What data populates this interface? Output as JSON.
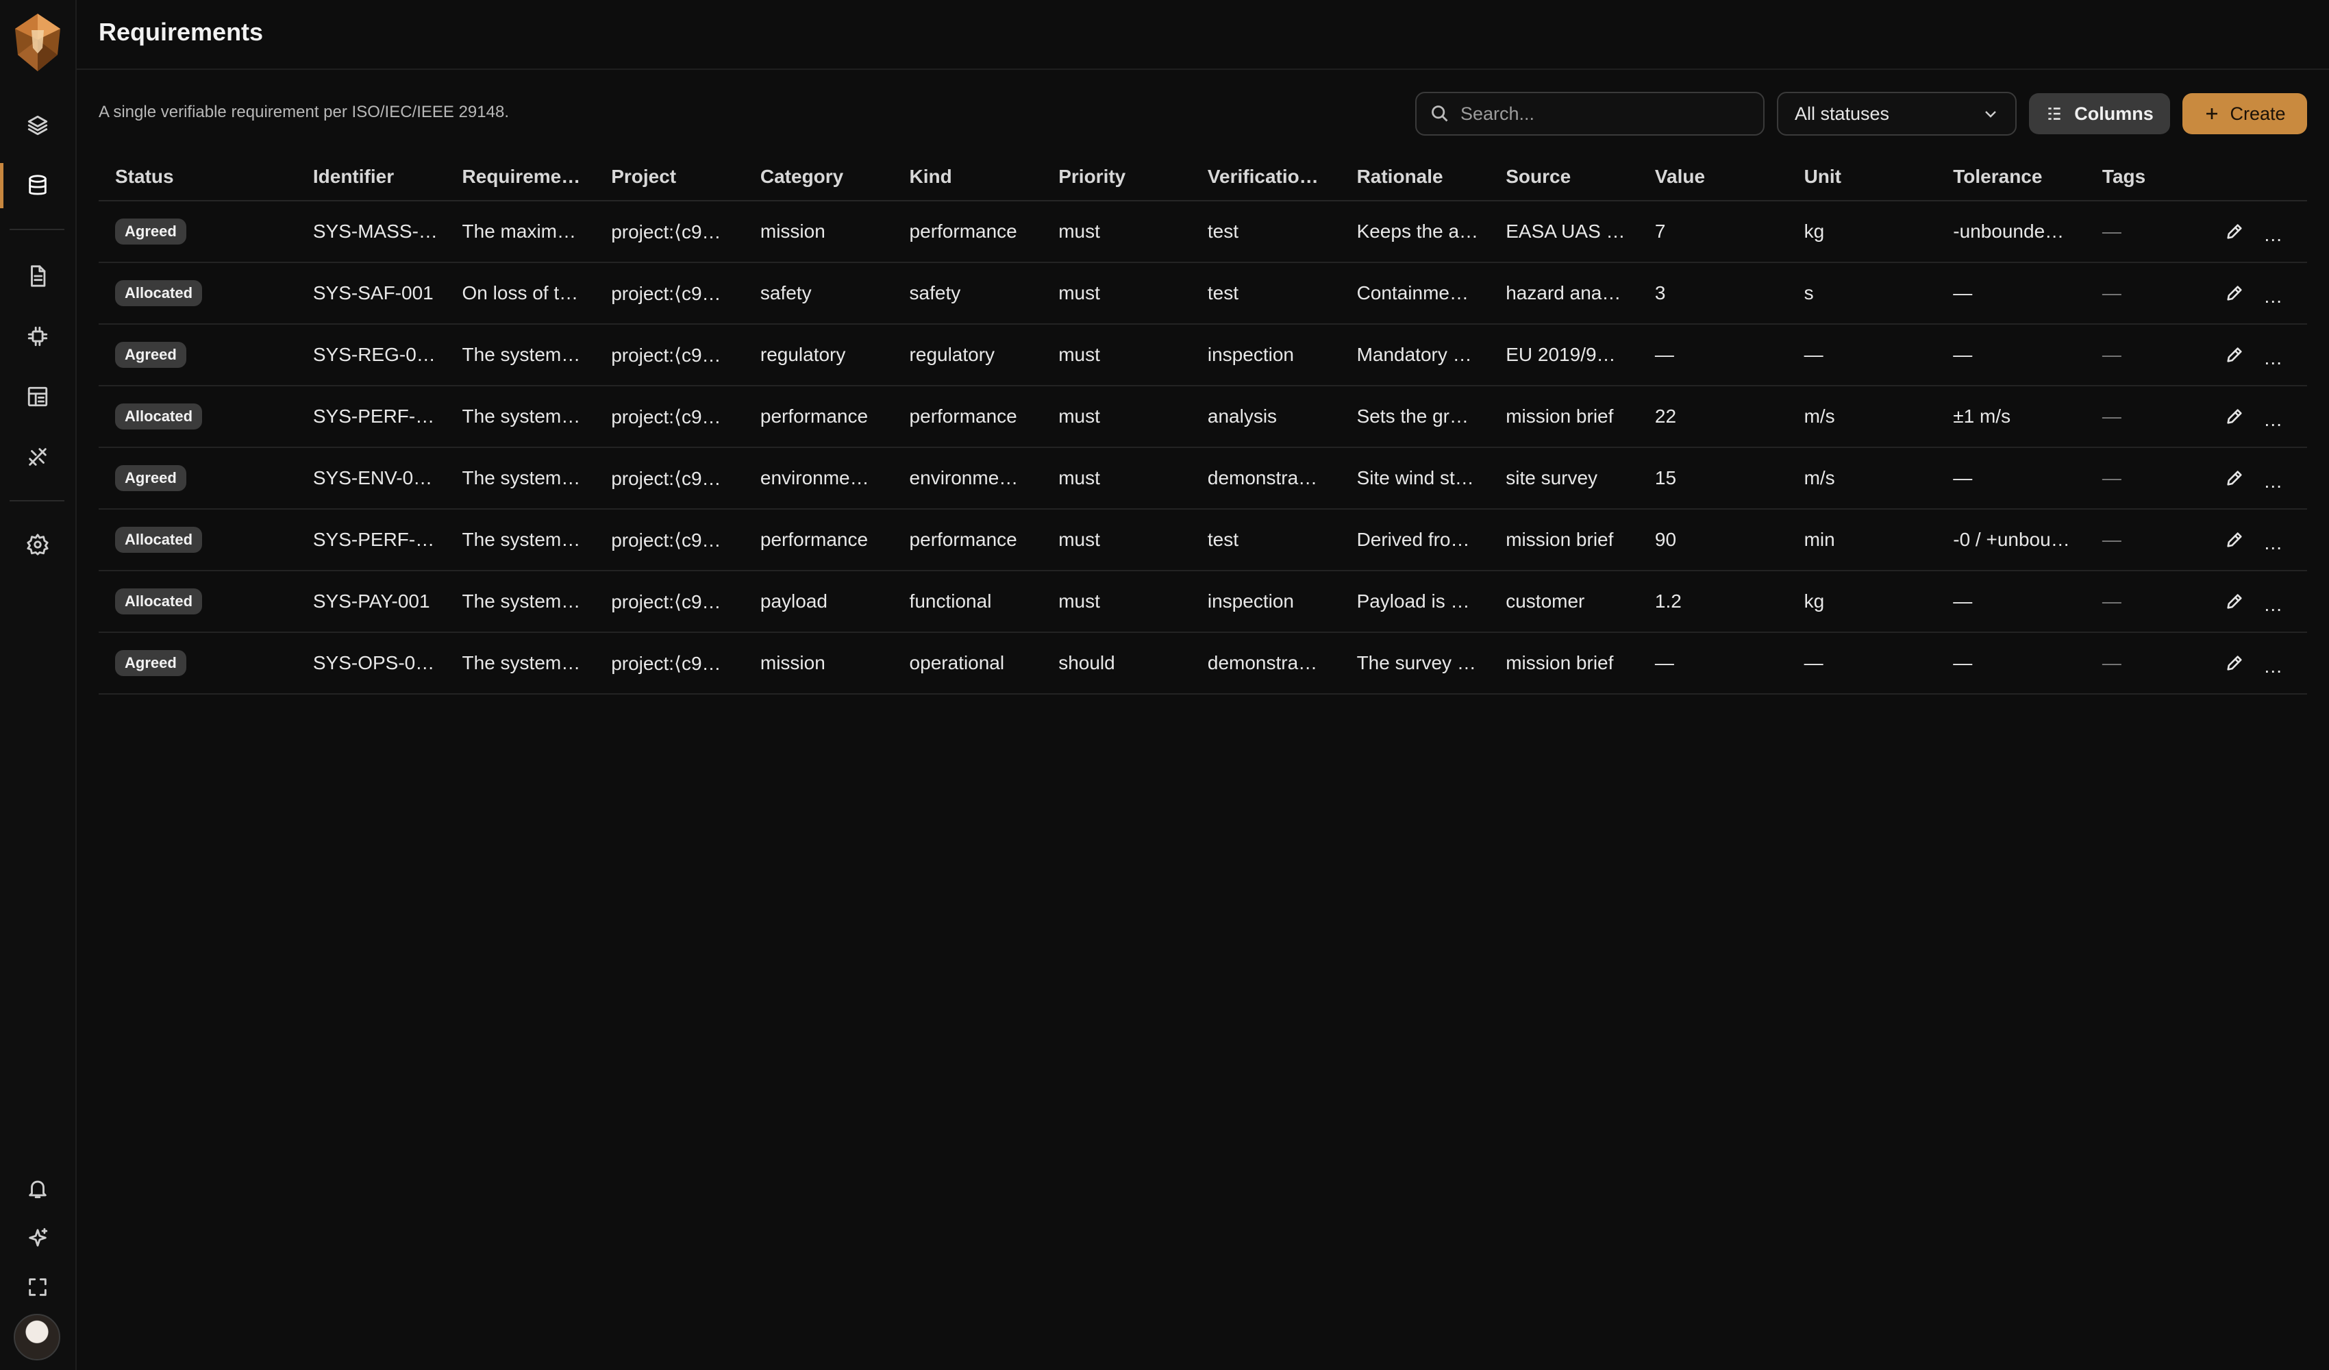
{
  "page": {
    "title": "Requirements",
    "description": "A single verifiable requirement per ISO/IEC/IEEE 29148."
  },
  "sidebar": {
    "top_items": [
      {
        "name": "layers-icon",
        "active": false
      },
      {
        "name": "database-icon",
        "active": true
      }
    ],
    "mid_items": [
      {
        "name": "document-icon"
      },
      {
        "name": "chip-icon"
      },
      {
        "name": "list-layout-icon"
      },
      {
        "name": "tools-icon"
      }
    ],
    "settings_icon": "gear-icon",
    "bottom_items": [
      {
        "name": "bell-icon"
      },
      {
        "name": "sparkle-icon"
      },
      {
        "name": "fullscreen-icon"
      }
    ]
  },
  "toolbar": {
    "search_placeholder": "Search...",
    "status_filter": "All statuses",
    "columns_label": "Columns",
    "create_label": "Create"
  },
  "table": {
    "columns": [
      "Status",
      "Identifier",
      "Requireme…",
      "Project",
      "Category",
      "Kind",
      "Priority",
      "Verificatio…",
      "Rationale",
      "Source",
      "Value",
      "Unit",
      "Tolerance",
      "Tags"
    ],
    "rows": [
      {
        "status": "Agreed",
        "identifier": "SYS-MASS-…",
        "requirement": "The maxim…",
        "project": "project:⟨c9…",
        "category": "mission",
        "kind": "performance",
        "priority": "must",
        "verification": "test",
        "rationale": "Keeps the a…",
        "source": "EASA UAS …",
        "value": "7",
        "unit": "kg",
        "tolerance": "-unbounde…",
        "tags": "—"
      },
      {
        "status": "Allocated",
        "identifier": "SYS-SAF-001",
        "requirement": "On loss of t…",
        "project": "project:⟨c9…",
        "category": "safety",
        "kind": "safety",
        "priority": "must",
        "verification": "test",
        "rationale": "Containme…",
        "source": "hazard ana…",
        "value": "3",
        "unit": "s",
        "tolerance": "—",
        "tags": "—"
      },
      {
        "status": "Agreed",
        "identifier": "SYS-REG-0…",
        "requirement": "The system…",
        "project": "project:⟨c9…",
        "category": "regulatory",
        "kind": "regulatory",
        "priority": "must",
        "verification": "inspection",
        "rationale": "Mandatory …",
        "source": "EU 2019/9…",
        "value": "—",
        "unit": "—",
        "tolerance": "—",
        "tags": "—"
      },
      {
        "status": "Allocated",
        "identifier": "SYS-PERF-…",
        "requirement": "The system…",
        "project": "project:⟨c9…",
        "category": "performance",
        "kind": "performance",
        "priority": "must",
        "verification": "analysis",
        "rationale": "Sets the gr…",
        "source": "mission brief",
        "value": "22",
        "unit": "m/s",
        "tolerance": "±1 m/s",
        "tags": "—"
      },
      {
        "status": "Agreed",
        "identifier": "SYS-ENV-0…",
        "requirement": "The system…",
        "project": "project:⟨c9…",
        "category": "environme…",
        "kind": "environme…",
        "priority": "must",
        "verification": "demonstra…",
        "rationale": "Site wind st…",
        "source": "site survey",
        "value": "15",
        "unit": "m/s",
        "tolerance": "—",
        "tags": "—"
      },
      {
        "status": "Allocated",
        "identifier": "SYS-PERF-…",
        "requirement": "The system…",
        "project": "project:⟨c9…",
        "category": "performance",
        "kind": "performance",
        "priority": "must",
        "verification": "test",
        "rationale": "Derived fro…",
        "source": "mission brief",
        "value": "90",
        "unit": "min",
        "tolerance": "-0 / +unbou…",
        "tags": "—"
      },
      {
        "status": "Allocated",
        "identifier": "SYS-PAY-001",
        "requirement": "The system…",
        "project": "project:⟨c9…",
        "category": "payload",
        "kind": "functional",
        "priority": "must",
        "verification": "inspection",
        "rationale": "Payload is …",
        "source": "customer",
        "value": "1.2",
        "unit": "kg",
        "tolerance": "—",
        "tags": "—"
      },
      {
        "status": "Agreed",
        "identifier": "SYS-OPS-0…",
        "requirement": "The system…",
        "project": "project:⟨c9…",
        "category": "mission",
        "kind": "operational",
        "priority": "should",
        "verification": "demonstra…",
        "rationale": "The survey …",
        "source": "mission brief",
        "value": "—",
        "unit": "—",
        "tolerance": "—",
        "tags": "—"
      }
    ]
  },
  "colors": {
    "accent": "#c98a3f",
    "background": "#0d0d0d",
    "badge": "#3b3b3b"
  }
}
